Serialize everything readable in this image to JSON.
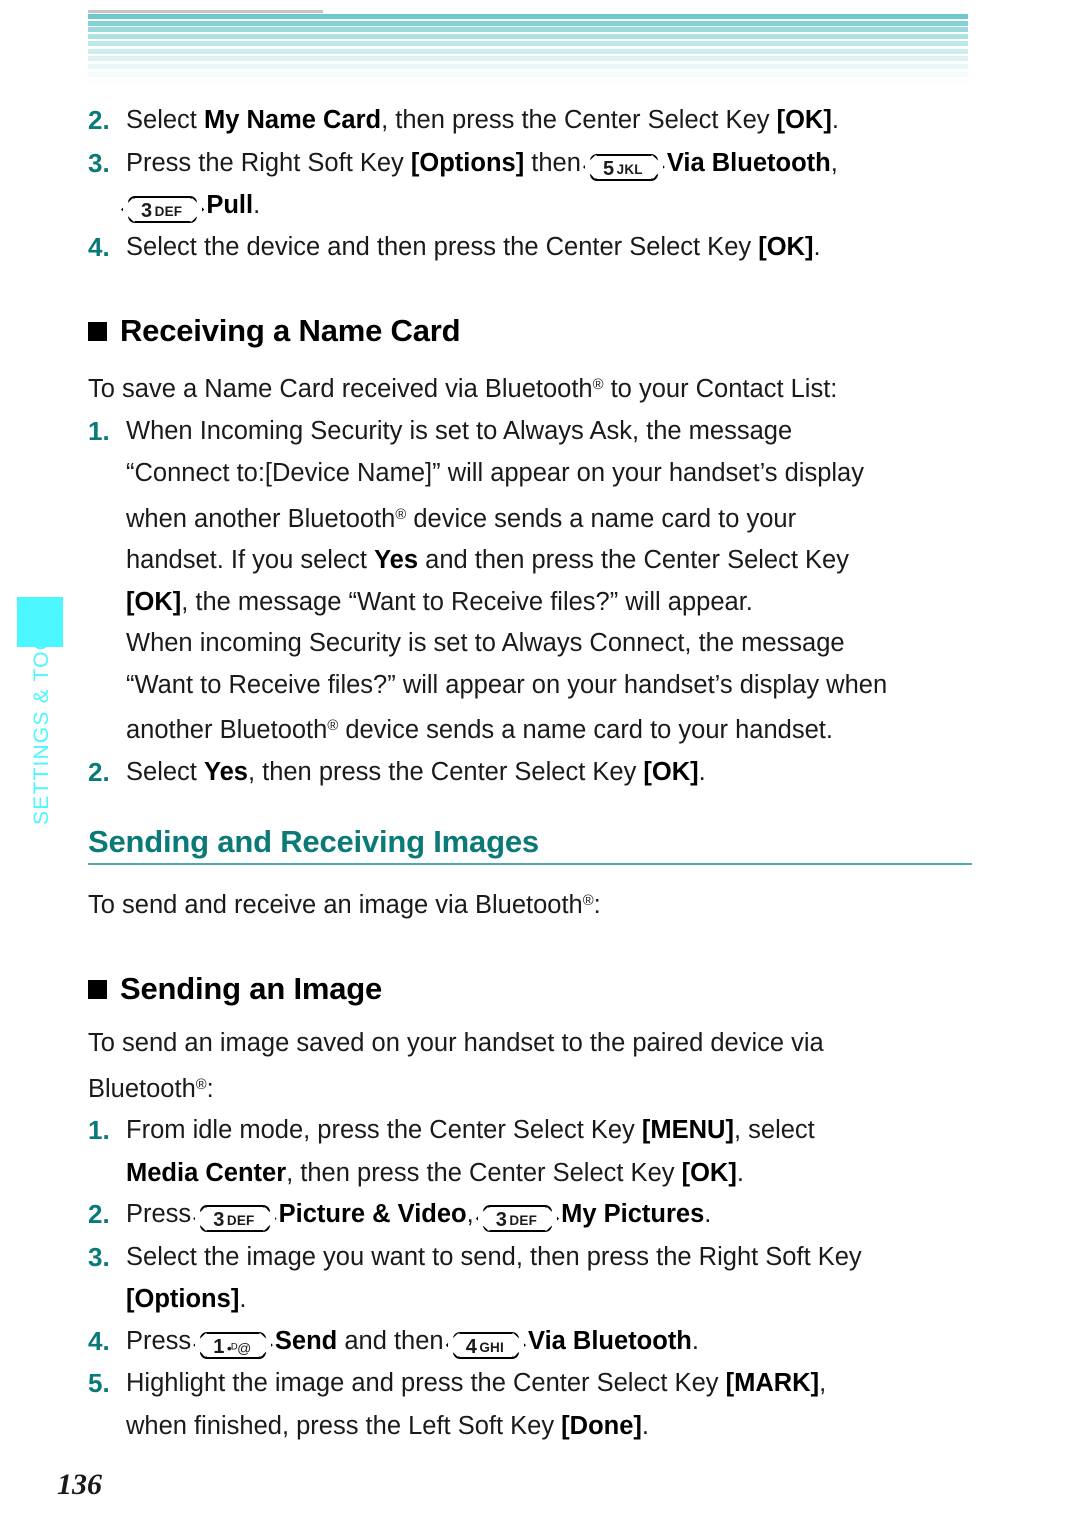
{
  "page": {
    "number": "136",
    "side_tab_label": "SETTINGS & TOOLS",
    "accent_teal": "#0a7a78",
    "accent_cyan": "#4df7ff",
    "header_stripe_color": "#6dc9ce",
    "rule_color": "#4fa8ad"
  },
  "top_steps": [
    {
      "num": "2.",
      "parts": [
        {
          "t": "Select ",
          "b": false
        },
        {
          "t": "My Name Card",
          "b": true
        },
        {
          "t": ", then press the Center Select Key ",
          "b": false
        },
        {
          "t": "[OK]",
          "b": true
        },
        {
          "t": ".",
          "b": false
        }
      ]
    },
    {
      "num": "3.",
      "parts": [
        {
          "t": "Press the Right Soft Key ",
          "b": false
        },
        {
          "t": "[Options]",
          "b": true
        },
        {
          "t": " then ",
          "b": false
        },
        {
          "key": {
            "digit": "5",
            "letters": "JKL"
          }
        },
        {
          "t": " ",
          "b": false
        },
        {
          "t": "Via Bluetooth",
          "b": true
        },
        {
          "t": ",",
          "b": false
        }
      ],
      "cont": [
        {
          "key": {
            "digit": "3",
            "letters": "DEF"
          }
        },
        {
          "t": " ",
          "b": false
        },
        {
          "t": "Pull",
          "b": true
        },
        {
          "t": ".",
          "b": false
        }
      ]
    },
    {
      "num": "4.",
      "parts": [
        {
          "t": "Select the device and then press the Center Select Key ",
          "b": false
        },
        {
          "t": "[OK]",
          "b": true
        },
        {
          "t": ".",
          "b": false
        }
      ]
    }
  ],
  "section_receiving": {
    "heading": "Receiving a Name Card",
    "intro_parts": [
      {
        "t": "To save a Name Card received via Bluetooth",
        "b": false
      },
      {
        "reg": "®"
      },
      {
        "t": " to your Contact List:",
        "b": false
      }
    ],
    "steps": [
      {
        "num": "1.",
        "lines": [
          [
            {
              "t": "When Incoming Security is set to Always Ask, the message",
              "b": false
            }
          ],
          [
            {
              "t": "“Connect to:[Device Name]” will appear on your handset’s display",
              "b": false
            }
          ],
          [
            {
              "t": "when another Bluetooth",
              "b": false
            },
            {
              "reg": "®"
            },
            {
              "t": " device sends a name card to your",
              "b": false
            }
          ],
          [
            {
              "t": "handset. If you select ",
              "b": false
            },
            {
              "t": "Yes",
              "b": true
            },
            {
              "t": " and then press the Center Select Key",
              "b": false
            }
          ],
          [
            {
              "t": "[OK]",
              "b": true
            },
            {
              "t": ", the message “Want to Receive files?” will appear.",
              "b": false
            }
          ],
          [
            {
              "t": "When incoming Security is set to Always Connect, the message",
              "b": false
            }
          ],
          [
            {
              "t": "“Want to Receive files?” will appear on your handset’s display when",
              "b": false
            }
          ],
          [
            {
              "t": "another Bluetooth",
              "b": false
            },
            {
              "reg": "®"
            },
            {
              "t": " device sends a name card to your handset.",
              "b": false
            }
          ]
        ]
      },
      {
        "num": "2.",
        "lines": [
          [
            {
              "t": "Select ",
              "b": false
            },
            {
              "t": "Yes",
              "b": true
            },
            {
              "t": ", then press the Center Select Key ",
              "b": false
            },
            {
              "t": "[OK]",
              "b": true
            },
            {
              "t": ".",
              "b": false
            }
          ]
        ]
      }
    ]
  },
  "section_sending_receiving": {
    "heading": "Sending and Receiving Images",
    "intro_parts": [
      {
        "t": "To send and receive an image via Bluetooth",
        "b": false
      },
      {
        "reg": "®"
      },
      {
        "t": ":",
        "b": false
      }
    ]
  },
  "section_sending_image": {
    "heading": "Sending an Image",
    "intro_lines": [
      [
        {
          "t": "To send an image saved on your handset to the paired device via",
          "b": false
        }
      ],
      [
        {
          "t": "Bluetooth",
          "b": false
        },
        {
          "reg": "®"
        },
        {
          "t": ":",
          "b": false
        }
      ]
    ],
    "steps": [
      {
        "num": "1.",
        "lines": [
          [
            {
              "t": "From idle mode, press the Center Select Key ",
              "b": false
            },
            {
              "t": "[MENU]",
              "b": true
            },
            {
              "t": ", select",
              "b": false
            }
          ],
          [
            {
              "t": "Media Center",
              "b": true
            },
            {
              "t": ", then press the Center Select Key ",
              "b": false
            },
            {
              "t": "[OK]",
              "b": true
            },
            {
              "t": ".",
              "b": false
            }
          ]
        ]
      },
      {
        "num": "2.",
        "lines": [
          [
            {
              "t": "Press ",
              "b": false
            },
            {
              "key": {
                "digit": "3",
                "letters": "DEF"
              }
            },
            {
              "t": " ",
              "b": false
            },
            {
              "t": "Picture & Video",
              "b": true
            },
            {
              "t": ", ",
              "b": false
            },
            {
              "key": {
                "digit": "3",
                "letters": "DEF"
              }
            },
            {
              "t": " ",
              "b": false
            },
            {
              "t": "My Pictures",
              "b": true
            },
            {
              "t": ".",
              "b": false
            }
          ]
        ]
      },
      {
        "num": "3.",
        "lines": [
          [
            {
              "t": "Select the image you want to send, then press the Right Soft Key",
              "b": false
            }
          ],
          [
            {
              "t": "[Options]",
              "b": true
            },
            {
              "t": ".",
              "b": false
            }
          ]
        ]
      },
      {
        "num": "4.",
        "lines": [
          [
            {
              "t": "Press ",
              "b": false
            },
            {
              "key": {
                "digit": "1",
                "symbols": "•ᴰ@"
              }
            },
            {
              "t": " ",
              "b": false
            },
            {
              "t": "Send",
              "b": true
            },
            {
              "t": " and then ",
              "b": false
            },
            {
              "key": {
                "digit": "4",
                "letters": "GHI"
              }
            },
            {
              "t": " ",
              "b": false
            },
            {
              "t": "Via Bluetooth",
              "b": true
            },
            {
              "t": ".",
              "b": false
            }
          ]
        ]
      },
      {
        "num": "5.",
        "lines": [
          [
            {
              "t": "Highlight the image and press the Center Select Key ",
              "b": false
            },
            {
              "t": "[MARK]",
              "b": true
            },
            {
              "t": ",",
              "b": false
            }
          ],
          [
            {
              "t": "when finished, press the Left Soft Key ",
              "b": false
            },
            {
              "t": "[Done]",
              "b": true
            },
            {
              "t": ".",
              "b": false
            }
          ]
        ]
      }
    ]
  }
}
